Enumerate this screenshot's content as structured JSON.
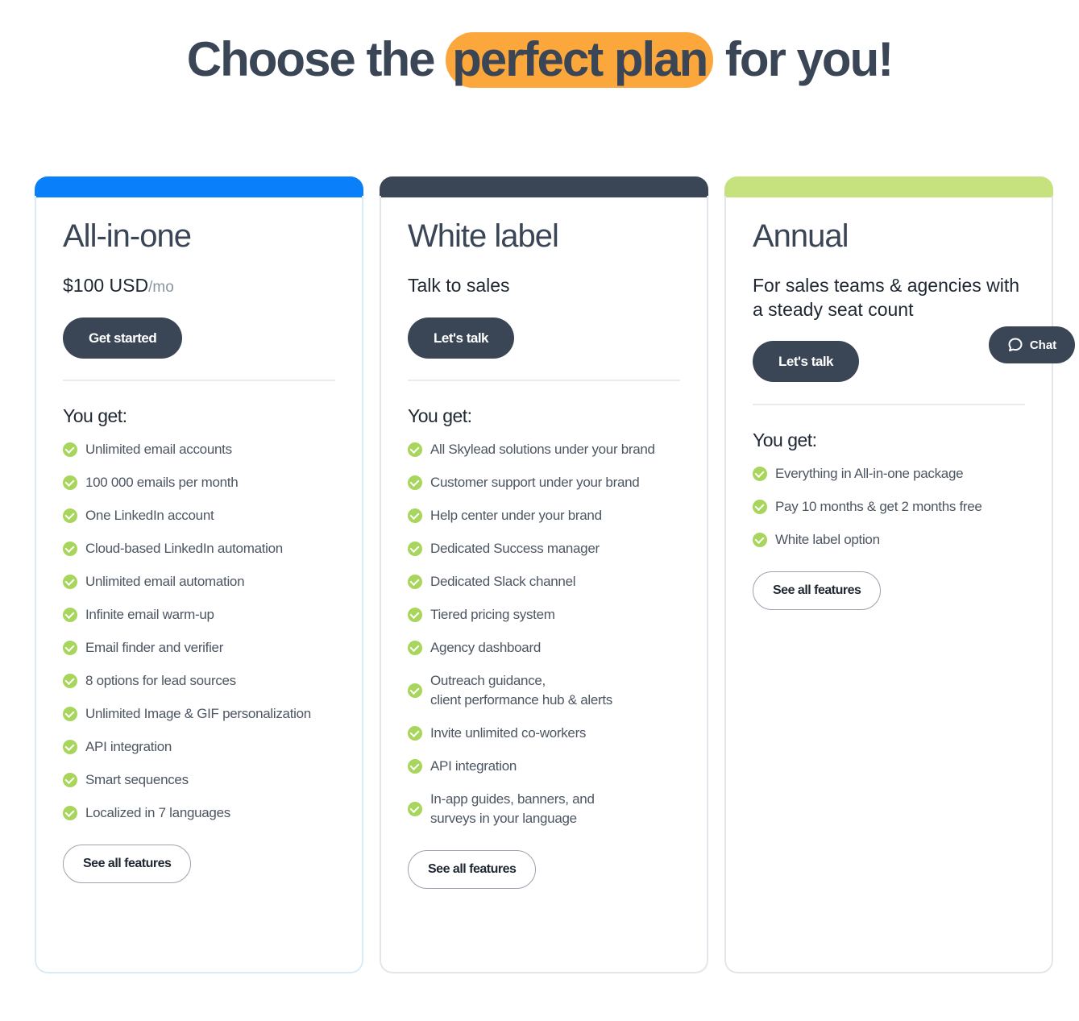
{
  "headline": {
    "before": "Choose the",
    "highlight": "perfect plan",
    "after": "for you!"
  },
  "plans": [
    {
      "name": "All-in-one",
      "price": "$100 USD",
      "price_unit": "/mo",
      "cta": "Get started",
      "you_get": "You get:",
      "features": [
        "Unlimited email accounts",
        "100 000 emails per month",
        "One LinkedIn account",
        "Cloud-based LinkedIn automation",
        "Unlimited email automation",
        "Infinite email warm-up",
        "Email finder and verifier",
        "8 options for lead sources",
        "Unlimited Image & GIF personalization",
        "API integration",
        "Smart sequences",
        "Localized in 7 languages"
      ],
      "see_all": "See all features"
    },
    {
      "name": "White label",
      "price": "Talk to sales",
      "cta": "Let's talk",
      "you_get": "You get:",
      "features": [
        "All Skylead solutions under your brand",
        "Customer support under your brand",
        "Help center under your brand",
        "Dedicated Success manager",
        "Dedicated Slack channel",
        "Tiered pricing system",
        "Agency dashboard",
        "Outreach guidance,\nclient performance hub & alerts",
        "Invite unlimited co-workers",
        "API integration",
        "In-app guides, banners, and\nsurveys in your language"
      ],
      "see_all": "See all features"
    },
    {
      "name": "Annual",
      "description": "For sales teams & agencies with a steady seat count",
      "cta": "Let's talk",
      "you_get": "You get:",
      "features": [
        "Everything in All-in-one package",
        "Pay 10 months & get 2 months free",
        "White label option"
      ],
      "see_all": "See all features"
    }
  ],
  "chat": {
    "label": "Chat"
  },
  "colors": {
    "accent_highlight": "#fca73b",
    "all_in_one_bar": "#0a7ffa",
    "white_label_bar": "#3a4556",
    "annual_bar": "#c6e27e",
    "check": "#a8d65c",
    "button_dark": "#3a4556"
  }
}
